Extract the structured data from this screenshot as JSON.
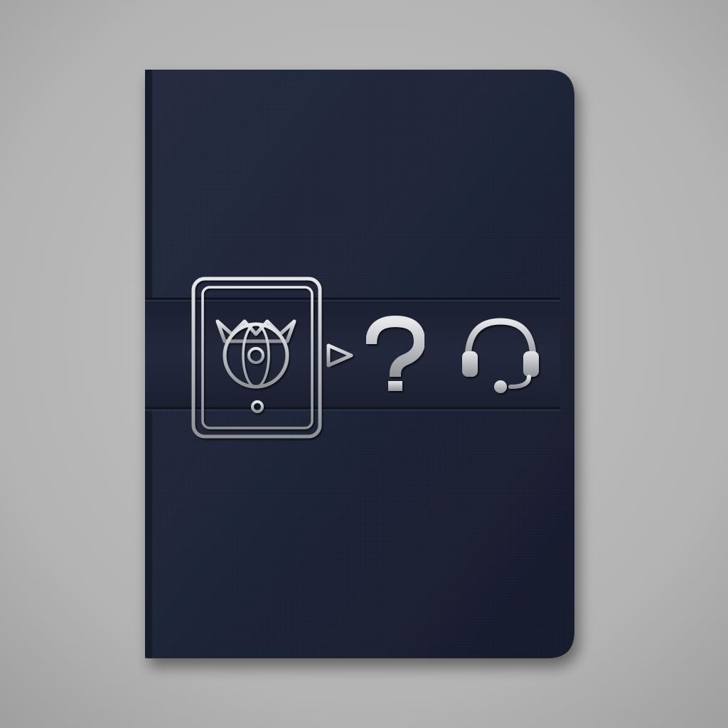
{
  "scene": {
    "subject": "passport-cover",
    "background_color": "#b9b9b9",
    "cover_color": "#20263a",
    "emboss_color": "#c9cacd",
    "icons": [
      "passport-document-icon",
      "arrow-right-icon",
      "question-mark-icon",
      "headset-icon"
    ]
  }
}
